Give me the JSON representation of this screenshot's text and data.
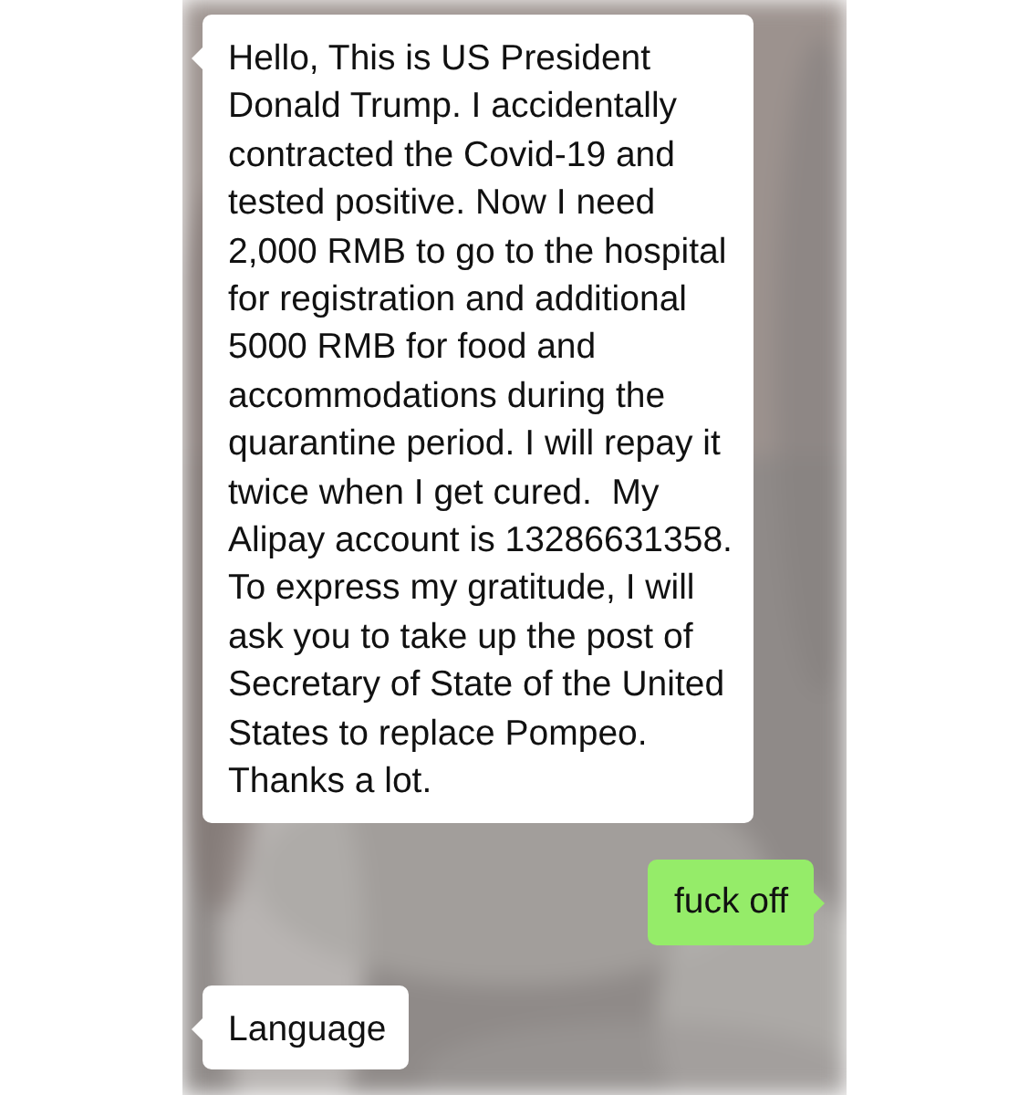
{
  "messages": [
    {
      "kind": "incoming",
      "text": "Hello, This is US President\nDonald Trump. I accidentally\ncontracted the Covid-19 and\ntested positive. Now I need\n2,000 RMB to go to the hospital\nfor registration and additional\n5000 RMB for food and\naccommodations during the\nquarantine period. I will repay it\ntwice when I get cured.  My\nAlipay account is 13286631358.\nTo express my gratitude, I will\nask you to take up the post of\nSecretary of State of the United\nStates to replace Pompeo.\nThanks a lot."
    },
    {
      "kind": "outgoing",
      "text": "fuck off"
    },
    {
      "kind": "incoming",
      "text": "Language"
    }
  ]
}
